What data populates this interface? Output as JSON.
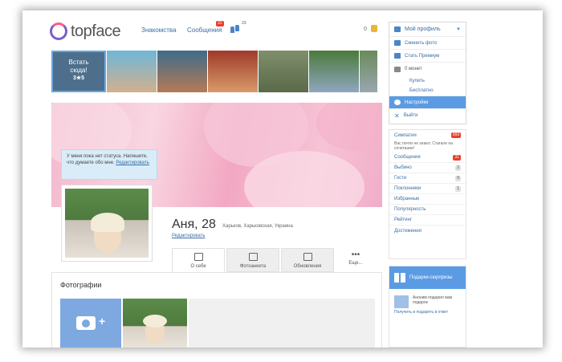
{
  "header": {
    "logo": "topface",
    "nav": {
      "dating": "Знакомства",
      "messages": "Сообщения",
      "messages_badge": "31",
      "people_count": "23"
    },
    "coins": "0"
  },
  "strip": {
    "cta_line1": "Встать",
    "cta_line2": "сюда!",
    "cta_count": "3★5"
  },
  "profile": {
    "status_text": "У меня пока нет статуса. Напишите, что думаете обо мне.",
    "status_edit": "Редактировать",
    "name": "Аня, 28",
    "location": "Харьков, Харьковская, Украина",
    "edit": "Редактировать"
  },
  "tabs": [
    {
      "label": "О себе"
    },
    {
      "label": "Фотоанкета"
    },
    {
      "label": "Обновления"
    },
    {
      "label": "Еще..."
    }
  ],
  "photos": {
    "title": "Фотографии"
  },
  "menu": {
    "header": "Мой профиль",
    "items": {
      "change_photo": "Сменить фото",
      "premium": "Стать Премиум",
      "coins": "0 монет",
      "buy": "Купить",
      "free": "Бесплатно",
      "settings": "Настройки",
      "logout": "Выйти"
    }
  },
  "stats": {
    "likes": "Симпатии",
    "likes_badge": "269",
    "likes_note": "Вас почти не знают. Станьте на сочетание!",
    "messages": "Сообщения",
    "messages_badge": "31",
    "views": "Выбино",
    "views_badge": "2",
    "guests": "Гости",
    "guests_badge": "9",
    "fans": "Поклонники",
    "fans_badge": "1",
    "favorites": "Избранные",
    "popularity": "Популярность",
    "rating": "Рейтинг",
    "achievements": "Достижения"
  },
  "gifts": {
    "title": "Подарки-сюрпризы",
    "text": "Аноним подарил вам подарок",
    "link": "Получить и подарить в ответ"
  },
  "colors": {
    "accent": "#5b9be3",
    "badge": "#e8402a",
    "link": "#3a6ea5"
  }
}
